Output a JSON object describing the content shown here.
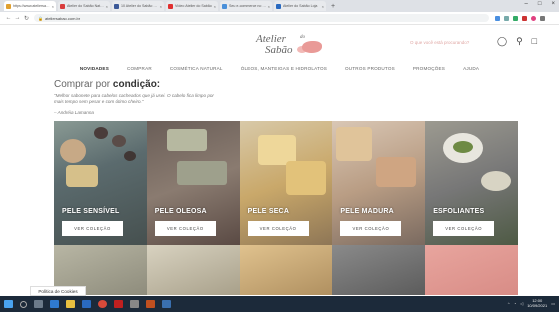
{
  "browser": {
    "tabs": [
      {
        "title": "https://www.ateliersabao.com.br",
        "color": "#e0a030",
        "active": true
      },
      {
        "title": "Atelier do Sabão Naturais",
        "color": "#d93c3c",
        "active": false
      },
      {
        "title": "10 Atelier do Sabão Facebook",
        "color": "#3b5998",
        "active": false
      },
      {
        "title": "Vídeo Atelier do Sabão",
        "color": "#e03030",
        "active": false
      },
      {
        "title": "Seu e-commerce no figma",
        "color": "#4a90d9",
        "active": false
      },
      {
        "title": "Atelier do Sabão Loja",
        "color": "#2a6ac0",
        "active": false
      }
    ],
    "url": "ateliersabao.com.br",
    "new_tab": "+"
  },
  "site": {
    "logo_line1": "Atelier",
    "logo_do": "do",
    "logo_line2": "Sabão",
    "search_placeholder": "O que você está procurando?",
    "header_icons": [
      "user-icon",
      "search-icon",
      "cart-icon"
    ],
    "nav": [
      {
        "label": "NOVIDADES",
        "bold": true
      },
      {
        "label": "COMPRAR",
        "bold": false
      },
      {
        "label": "COSMÉTICA NATURAL",
        "bold": false
      },
      {
        "label": "ÓLEOS, MANTEIGAS E HIDROLATOS",
        "bold": false
      },
      {
        "label": "OUTROS PRODUTOS",
        "bold": false
      },
      {
        "label": "PROMOÇÕES",
        "bold": false
      },
      {
        "label": "AJUDA",
        "bold": false
      }
    ],
    "section_title_prefix": "Comprar por ",
    "section_title_bold": "condição:",
    "quote": "\"Melhor sabonete para cabelos cacheados que já usei. O cabelo fica limpo por mais tempo sem pesar e com ótimo cheiro.\"",
    "quote_author": "– Andréia Lamanna",
    "cards": [
      {
        "label": "PELE SENSÍVEL",
        "button": "VER COLEÇÃO"
      },
      {
        "label": "PELE OLEOSA",
        "button": "VER COLEÇÃO"
      },
      {
        "label": "PELE SECA",
        "button": "VER COLEÇÃO"
      },
      {
        "label": "PELE MADURA",
        "button": "VER COLEÇÃO"
      },
      {
        "label": "ESFOLIANTES",
        "button": "VER COLEÇÃO"
      }
    ],
    "cookie_label": "Política de Cookies"
  },
  "colors": {
    "accent_pink": "#e99a97",
    "taskbar": "#1c2a3a"
  },
  "taskbar": {
    "time": "12:00",
    "date": "10/09/2021"
  }
}
